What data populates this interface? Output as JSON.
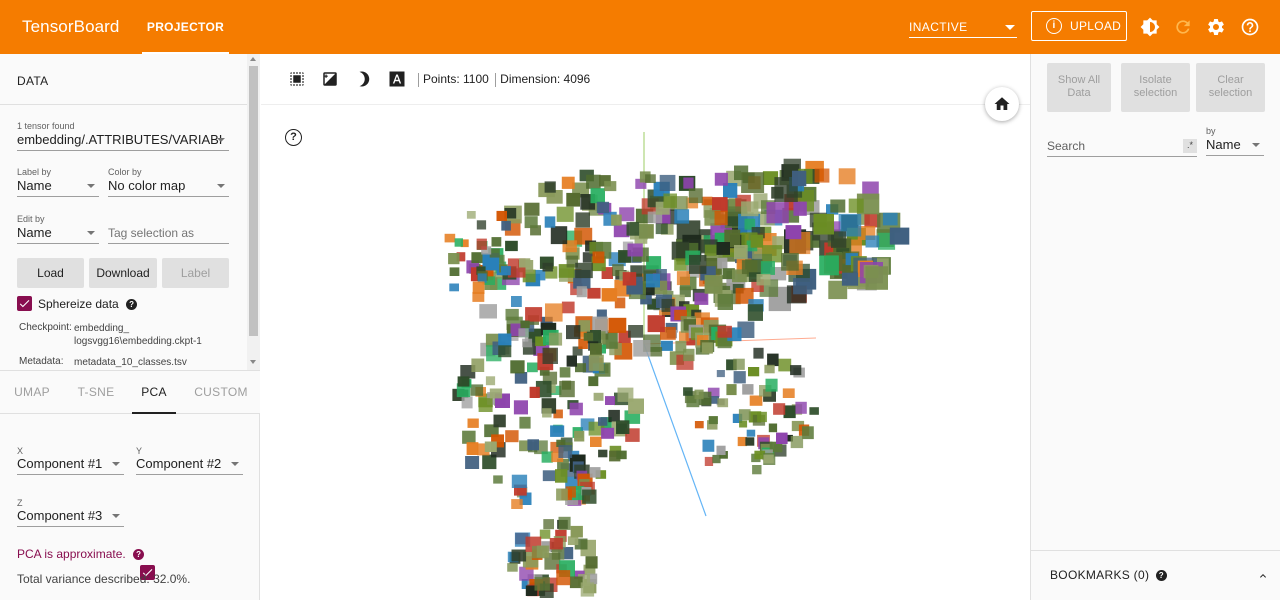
{
  "header": {
    "brand": "TensorBoard",
    "active_tab": "PROJECTOR",
    "run_select": "INACTIVE",
    "upload_label": "UPLOAD",
    "icons": [
      "brightness-icon",
      "refresh-icon",
      "settings-icon",
      "help-icon"
    ],
    "colors": {
      "bar": "#f57c00",
      "text": "#ffffff"
    }
  },
  "data_panel": {
    "title": "DATA",
    "tensor_count": "1 tensor found",
    "tensor_select": "embedding/.ATTRIBUTES/VARIABI",
    "label_by": {
      "label": "Label by",
      "value": "Name"
    },
    "color_by": {
      "label": "Color by",
      "value": "No color map"
    },
    "edit_by": {
      "label": "Edit by",
      "value": "Name"
    },
    "tag_selection_placeholder": "Tag selection as",
    "buttons": {
      "load": "Load",
      "download": "Download",
      "label": "Label"
    },
    "sphereize": {
      "label": "Sphereize data",
      "checked": true
    },
    "checkpoint": {
      "key": "Checkpoint:",
      "value_line1": "embedding_",
      "value_line2": "logsvgg16\\embedding.ckpt-1"
    },
    "metadata": {
      "key": "Metadata:",
      "value": "metadata_10_classes.tsv"
    },
    "accent": "#880e4f"
  },
  "projection_tabs": [
    {
      "label": "UMAP",
      "active": false
    },
    {
      "label": "T-SNE",
      "active": false
    },
    {
      "label": "PCA",
      "active": true
    },
    {
      "label": "CUSTOM",
      "active": false
    }
  ],
  "pca": {
    "x": {
      "label": "X",
      "value": "Component #1"
    },
    "y": {
      "label": "Y",
      "value": "Component #2"
    },
    "z": {
      "label": "Z",
      "value": "Component #3",
      "enabled": true
    },
    "approx_note": "PCA is approximate.",
    "variance": "Total variance described: 32.0%."
  },
  "canvas": {
    "info_points": "Points: 1100",
    "info_dimension": "Dimension: 4096",
    "tools": [
      "select-rect-icon",
      "night-mode-icon",
      "toggle-3d-icon",
      "labels-icon"
    ]
  },
  "inspector": {
    "buttons": {
      "show_all_1": "Show All",
      "show_all_2": "Data",
      "isolate_1": "Isolate",
      "isolate_2": "selection",
      "clear_1": "Clear",
      "clear_2": "selection"
    },
    "search_placeholder": "Search",
    "regex_label": ".*",
    "by_label": "by",
    "by_value": "Name",
    "bookmarks": "BOOKMARKS (0)"
  }
}
